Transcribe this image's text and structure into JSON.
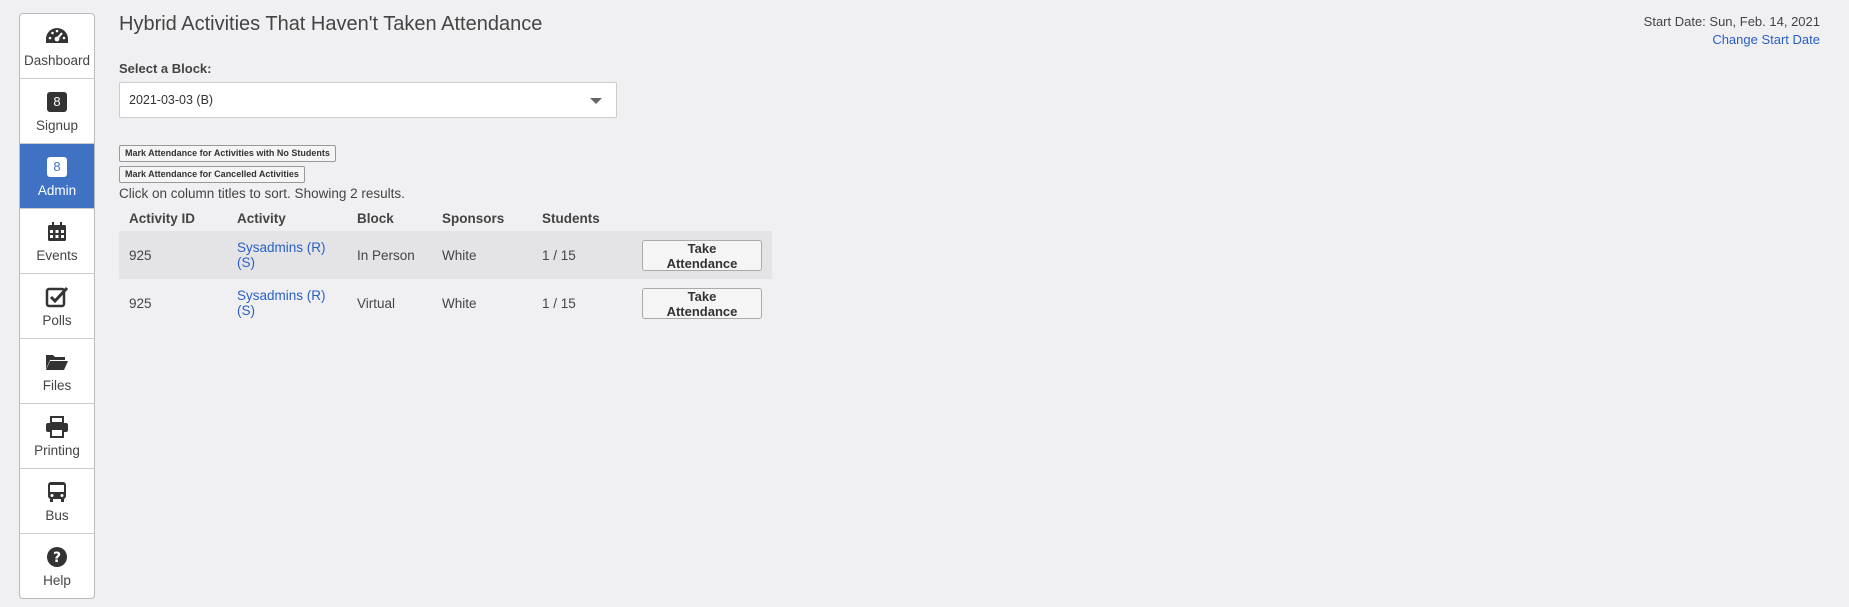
{
  "sidebar": {
    "items": [
      {
        "label": "Dashboard",
        "icon": "dashboard-icon"
      },
      {
        "label": "Signup",
        "badge": "8"
      },
      {
        "label": "Admin",
        "badge": "8",
        "active": true
      },
      {
        "label": "Events",
        "icon": "calendar-icon"
      },
      {
        "label": "Polls",
        "icon": "checkbox-icon"
      },
      {
        "label": "Files",
        "icon": "folder-icon"
      },
      {
        "label": "Printing",
        "icon": "printer-icon"
      },
      {
        "label": "Bus",
        "icon": "bus-icon"
      },
      {
        "label": "Help",
        "icon": "help-icon"
      }
    ]
  },
  "page": {
    "title": "Hybrid Activities That Haven't Taken Attendance",
    "start_date": "Start Date: Sun, Feb. 14, 2021",
    "change_start_date": "Change Start Date",
    "block_label": "Select a Block:",
    "block_value": "2021-03-03 (B)",
    "btn_no_students": "Mark Attendance for Activities with No Students",
    "btn_cancelled": "Mark Attendance for Cancelled Activities",
    "results_note": "Click on column titles to sort. Showing 2 results."
  },
  "table": {
    "headers": [
      "Activity ID",
      "Activity",
      "Block",
      "Sponsors",
      "Students"
    ],
    "rows": [
      {
        "id": "925",
        "activity": "Sysadmins (R) (S)",
        "block": "In Person",
        "sponsors": "White",
        "students": "1 / 15",
        "action": "Take Attendance"
      },
      {
        "id": "925",
        "activity": "Sysadmins (R) (S)",
        "block": "Virtual",
        "sponsors": "White",
        "students": "1 / 15",
        "action": "Take Attendance"
      }
    ]
  },
  "colors": {
    "accent": "#3f72c3",
    "link": "#2a5fc7",
    "background": "#f0f0f2"
  }
}
